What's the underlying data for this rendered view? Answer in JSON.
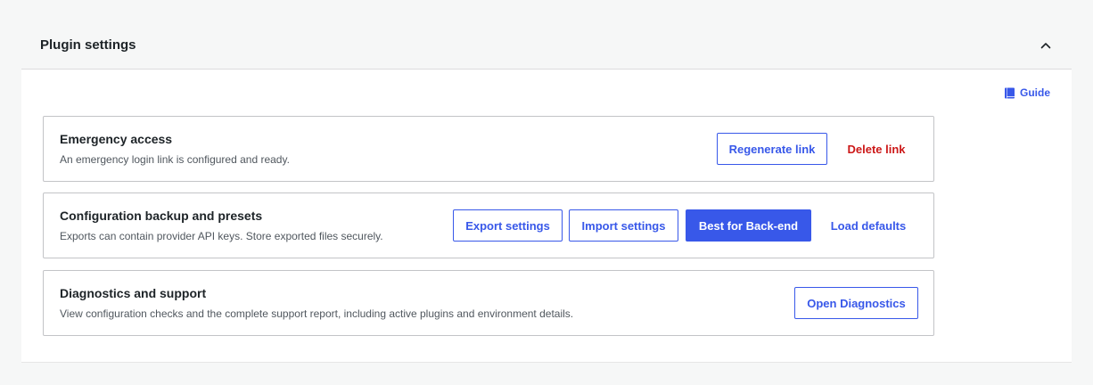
{
  "panel": {
    "title": "Plugin settings",
    "toggle_icon": "chevron-up-icon"
  },
  "guide": {
    "label": "Guide",
    "icon": "book-icon"
  },
  "cards": [
    {
      "title": "Emergency access",
      "description": "An emergency login link is configured and ready.",
      "actions": {
        "regenerate": "Regenerate link",
        "delete": "Delete link"
      }
    },
    {
      "title": "Configuration backup and presets",
      "description": "Exports can contain provider API keys. Store exported files securely.",
      "actions": {
        "export": "Export settings",
        "import": "Import settings",
        "preset": "Best for Back-end",
        "defaults": "Load defaults"
      }
    },
    {
      "title": "Diagnostics and support",
      "description": "View configuration checks and the complete support report, including active plugins and environment details.",
      "actions": {
        "open": "Open Diagnostics"
      }
    }
  ],
  "colors": {
    "accent": "#3858e9",
    "danger": "#cc1818",
    "border": "#c3c4c7",
    "background": "#f6f7f7"
  }
}
